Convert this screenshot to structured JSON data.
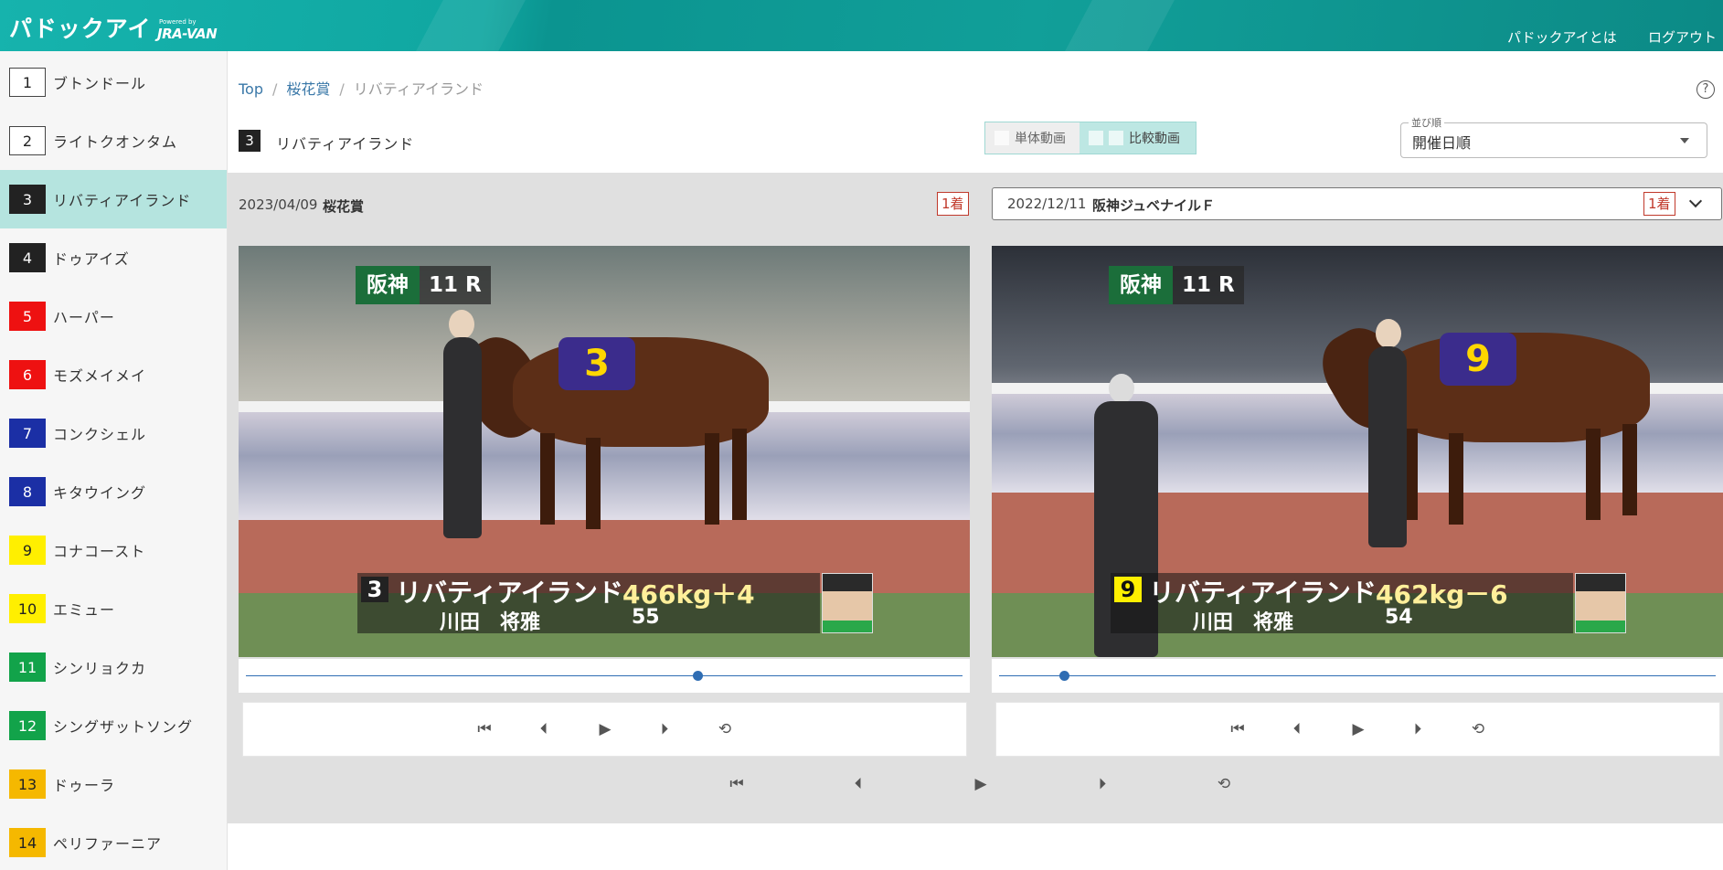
{
  "header": {
    "logo": "パドックアイ",
    "powered_by": "Powered by",
    "brand": "JRA-VAN",
    "nav": [
      "パドックアイとは",
      "ログアウト"
    ],
    "color": "#12a39d"
  },
  "sidebar": {
    "items": [
      {
        "num": "1",
        "name": "ブトンドール",
        "bg": "#ffffff",
        "fg": "#222222",
        "active": false
      },
      {
        "num": "2",
        "name": "ライトクオンタム",
        "bg": "#ffffff",
        "fg": "#222222",
        "active": false
      },
      {
        "num": "3",
        "name": "リバティアイランド",
        "bg": "#222222",
        "fg": "#ffffff",
        "active": true
      },
      {
        "num": "4",
        "name": "ドゥアイズ",
        "bg": "#222222",
        "fg": "#ffffff",
        "active": false
      },
      {
        "num": "5",
        "name": "ハーパー",
        "bg": "#ee1111",
        "fg": "#ffffff",
        "active": false
      },
      {
        "num": "6",
        "name": "モズメイメイ",
        "bg": "#ee1111",
        "fg": "#ffffff",
        "active": false
      },
      {
        "num": "7",
        "name": "コンクシェル",
        "bg": "#1b2fa5",
        "fg": "#ffffff",
        "active": false
      },
      {
        "num": "8",
        "name": "キタウイング",
        "bg": "#1b2fa5",
        "fg": "#ffffff",
        "active": false
      },
      {
        "num": "9",
        "name": "コナコースト",
        "bg": "#ffef00",
        "fg": "#222222",
        "active": false
      },
      {
        "num": "10",
        "name": "エミュー",
        "bg": "#ffef00",
        "fg": "#222222",
        "active": false
      },
      {
        "num": "11",
        "name": "シンリョクカ",
        "bg": "#12a34a",
        "fg": "#ffffff",
        "active": false
      },
      {
        "num": "12",
        "name": "シングザットソング",
        "bg": "#12a34a",
        "fg": "#ffffff",
        "active": false
      },
      {
        "num": "13",
        "name": "ドゥーラ",
        "bg": "#f5b800",
        "fg": "#222222",
        "active": false
      },
      {
        "num": "14",
        "name": "ペリファーニア",
        "bg": "#f5b800",
        "fg": "#222222",
        "active": false
      }
    ]
  },
  "breadcrumb": {
    "top": "Top",
    "race": "桜花賞",
    "current": "リバティアイランド",
    "sep": "/"
  },
  "help_icon": "?",
  "selected": {
    "num": "3",
    "name": "リバティアイランド"
  },
  "view_toggle": {
    "single": "単体動画",
    "compare": "比較動画"
  },
  "sort": {
    "label": "並び順",
    "value": "開催日順"
  },
  "left": {
    "date": "2023/04/09",
    "race": "桜花賞",
    "rank": "1着",
    "video": {
      "venue": "阪神",
      "race_no": "11 R",
      "saddle": "3",
      "num": "3",
      "horse": "リバティアイランド",
      "weight": "466kg＋4",
      "jockey": "川田　将雅",
      "load": "55"
    },
    "progress": 0.63
  },
  "right": {
    "date": "2022/12/11",
    "race": "阪神ジュベナイルＦ",
    "rank": "1着",
    "video": {
      "venue": "阪神",
      "race_no": "11 R",
      "saddle": "9",
      "num": "9",
      "horse": "リバティアイランド",
      "weight": "462kg－6",
      "jockey": "川田　将雅",
      "load": "54"
    },
    "progress": 0.09
  },
  "controls": {
    "skip_start": "⏮",
    "prev": "⏴",
    "play": "▶",
    "next": "⏵",
    "loop": "⟲"
  },
  "icons": [
    "skip-start-icon",
    "step-back-icon",
    "play-icon",
    "step-forward-icon",
    "loop-icon",
    "help-icon",
    "chevron-down-icon",
    "caret-down-icon"
  ]
}
